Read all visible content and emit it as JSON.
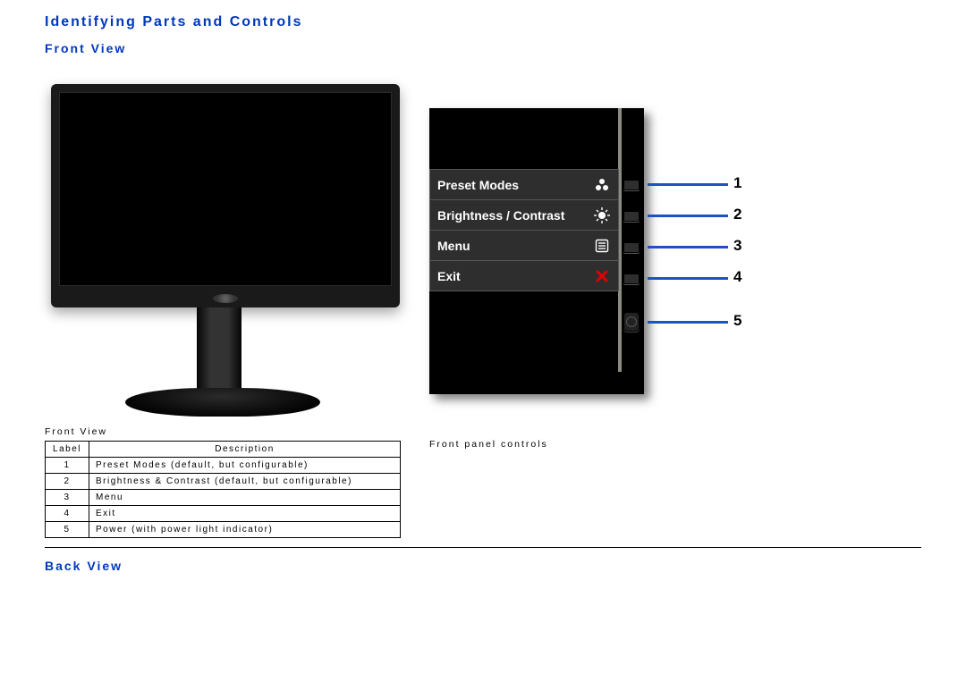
{
  "headings": {
    "main": "Identifying Parts and Controls",
    "front": "Front View",
    "back": "Back View"
  },
  "captions": {
    "front_view": "Front View",
    "front_panel_controls": "Front panel controls"
  },
  "monitor": {
    "brand_logo": "dell-logo"
  },
  "osd": {
    "menu": [
      {
        "label": "Preset Modes",
        "icon": "preset-modes-icon"
      },
      {
        "label": "Brightness / Contrast",
        "icon": "brightness-contrast-icon"
      },
      {
        "label": "Menu",
        "icon": "menu-icon"
      },
      {
        "label": "Exit",
        "icon": "exit-icon"
      }
    ],
    "callouts": [
      "1",
      "2",
      "3",
      "4",
      "5"
    ]
  },
  "controls_table": {
    "headers": {
      "label": "Label",
      "description": "Description"
    },
    "rows": [
      {
        "num": "1",
        "desc": "Preset Modes (default, but configurable)"
      },
      {
        "num": "2",
        "desc": "Brightness & Contrast (default, but configurable)"
      },
      {
        "num": "3",
        "desc": "Menu"
      },
      {
        "num": "4",
        "desc": "Exit"
      },
      {
        "num": "5",
        "desc": "Power (with power light indicator)"
      }
    ]
  }
}
